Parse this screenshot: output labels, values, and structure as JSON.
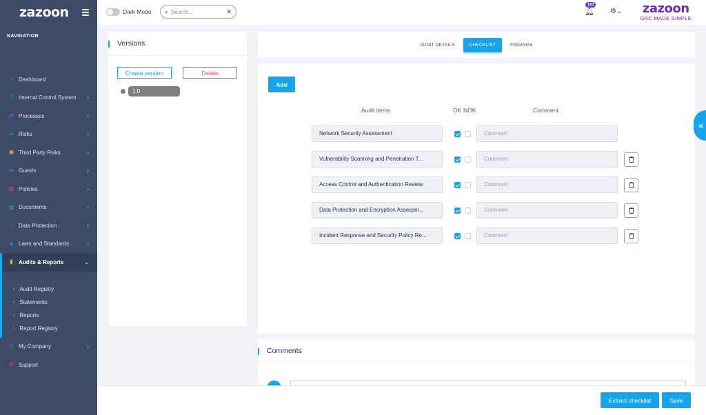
{
  "sidebar": {
    "logo": "zazoon",
    "caption": "NAVIGATION",
    "items": [
      {
        "label": "Dashboard",
        "icon": "dashboard-icon",
        "color": "#f0524b",
        "chev": ""
      },
      {
        "label": "Internal Control System",
        "icon": "control-icon",
        "color": "#17b7c8",
        "chev": "›"
      },
      {
        "label": "Processes",
        "icon": "processes-icon",
        "color": "#8a5cf0",
        "chev": "›"
      },
      {
        "label": "Risks",
        "icon": "risks-icon",
        "color": "#16a4ec",
        "chev": "›"
      },
      {
        "label": "Third Party Risks",
        "icon": "third-party-icon",
        "color": "#f5a623",
        "chev": "›"
      },
      {
        "label": "Guests",
        "icon": "guests-icon",
        "color": "#16a4ec",
        "chev": "›"
      },
      {
        "label": "Policies",
        "icon": "policies-icon",
        "color": "#f0524b",
        "chev": "›"
      },
      {
        "label": "Documents",
        "icon": "documents-icon",
        "color": "#17b7c8",
        "chev": "›"
      },
      {
        "label": "Data Protection",
        "icon": "data-protection-icon",
        "color": "#8a5cf0",
        "chev": "›"
      },
      {
        "label": "Laws and Standards",
        "icon": "laws-icon",
        "color": "#16a4ec",
        "chev": "›"
      },
      {
        "label": "Audits & Reports",
        "icon": "audits-icon",
        "color": "#f5a623",
        "chev": "⌄"
      }
    ],
    "sub_items": [
      "Audit Registry",
      "Statements",
      "Reports",
      "Report Registry"
    ],
    "after_items": [
      {
        "label": "My Company",
        "icon": "company-icon",
        "color": "#17b7c8",
        "chev": "›"
      },
      {
        "label": "Support",
        "icon": "support-icon",
        "color": "#f0524b",
        "chev": ""
      }
    ]
  },
  "topbar": {
    "dark_mode_label": "Dark Mode",
    "search_placeholder": "Search...",
    "notification_count": "150",
    "brand_name": "zazoon",
    "brand_tagline": "GRC MADE SIMPLE"
  },
  "versions": {
    "title": "Versions",
    "create_label": "Create version",
    "delete_label": "Delete",
    "current": "1.0"
  },
  "tabs": [
    "AUDIT DETAILS",
    "CHECKLIST",
    "FINDINGS"
  ],
  "checklist": {
    "add_label": "Add",
    "col_items": "Audit items",
    "col_ok": "OK",
    "col_nok": "NOK",
    "col_comment": "Comment",
    "comment_placeholder": "Comment",
    "rows": [
      {
        "item": "Network Security Assessment",
        "ok": true,
        "nok": false
      },
      {
        "item": "Vulnerability Scanning and Penetration T...",
        "ok": true,
        "nok": false
      },
      {
        "item": "Access Control and Authentication Review",
        "ok": true,
        "nok": false
      },
      {
        "item": "Data Protection and Encryption Assessm...",
        "ok": true,
        "nok": false
      },
      {
        "item": "Incident Response and Security Policy Re...",
        "ok": true,
        "nok": false
      }
    ]
  },
  "comments": {
    "title": "Comments"
  },
  "footer": {
    "extract_label": "Extract checklist",
    "save_label": "Save"
  },
  "ai_tab": "ai",
  "colors": {
    "accent": "#16a4ec",
    "sidebar": "#3d4b66",
    "brand": "#6a2ea7",
    "danger": "#f0524b"
  }
}
